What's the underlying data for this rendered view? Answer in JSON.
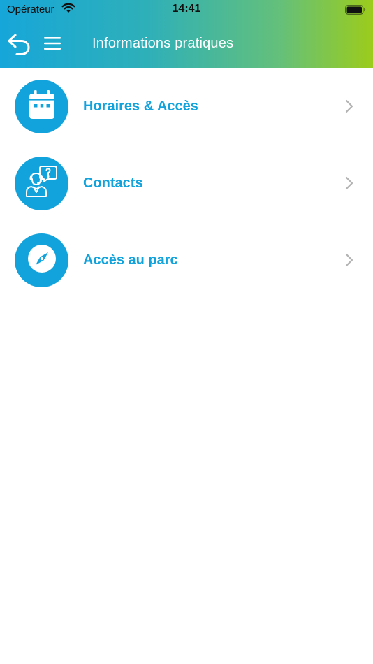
{
  "status_bar": {
    "carrier": "Opérateur",
    "time": "14:41",
    "icons": [
      "wifi-icon",
      "battery-icon"
    ]
  },
  "header": {
    "title": "Informations pratiques",
    "icons": [
      "back-icon",
      "menu-icon"
    ],
    "gradient": [
      "#16a6d9",
      "#9ccc1b"
    ]
  },
  "list": {
    "items": [
      {
        "label": "Horaires & Accès",
        "icon": "calendar-icon"
      },
      {
        "label": "Contacts",
        "icon": "support-agent-icon"
      },
      {
        "label": "Accès au parc",
        "icon": "compass-icon"
      }
    ]
  },
  "colors": {
    "accent": "#12a3dc",
    "divider": "#c7e6f3",
    "chevron": "#b3b3b3"
  }
}
